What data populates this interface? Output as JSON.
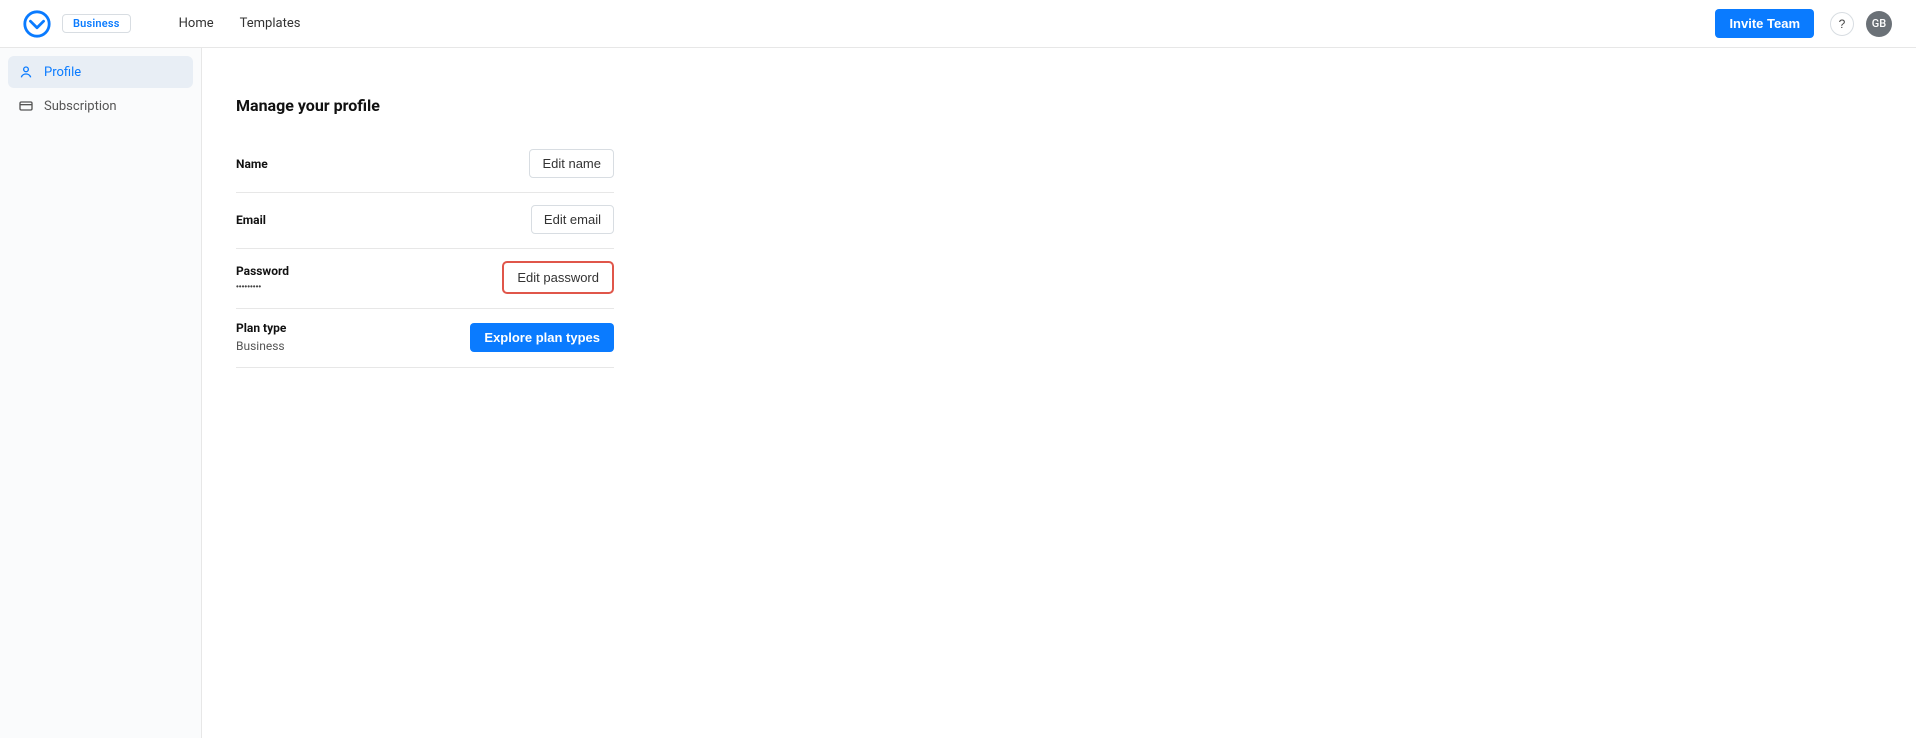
{
  "header": {
    "plan_badge": "Business",
    "nav": {
      "home": "Home",
      "templates": "Templates"
    },
    "invite_button": "Invite Team",
    "help_label": "?",
    "avatar_initials": "GB"
  },
  "sidebar": {
    "items": [
      {
        "label": "Profile",
        "active": true
      },
      {
        "label": "Subscription",
        "active": false
      }
    ]
  },
  "main": {
    "title": "Manage your profile",
    "rows": {
      "name": {
        "label": "Name",
        "button": "Edit name"
      },
      "email": {
        "label": "Email",
        "button": "Edit email"
      },
      "password": {
        "label": "Password",
        "mask": "•••••••••",
        "button": "Edit password"
      },
      "plan": {
        "label": "Plan type",
        "value": "Business",
        "button": "Explore plan types"
      }
    }
  }
}
